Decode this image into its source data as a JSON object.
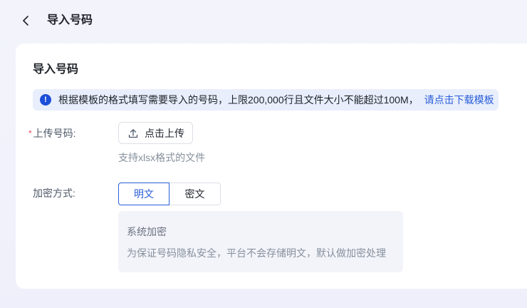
{
  "header": {
    "back_icon": "chevron-left-icon",
    "title": "导入号码"
  },
  "card": {
    "title": "导入号码",
    "notice": {
      "icon": "info-icon",
      "icon_glyph": "!",
      "text": "根据模板的格式填写需要导入的号码，上限200,000行且文件大小不能超过100M，",
      "link": "请点击下载模板"
    },
    "upload": {
      "required_mark": "*",
      "label": "上传号码:",
      "button_icon": "upload-icon",
      "button_label": "点击上传",
      "hint": "支持xlsx格式的文件"
    },
    "encryption": {
      "label": "加密方式:",
      "options": [
        "明文",
        "密文"
      ],
      "selected": "明文",
      "desc_title": "系统加密",
      "desc_body": "为保证号码隐私安全，平台不会存储明文，默认做加密处理"
    }
  },
  "colors": {
    "accent": "#2b5fd9",
    "notice_bg": "#e8eefc",
    "required": "#e34d59"
  }
}
